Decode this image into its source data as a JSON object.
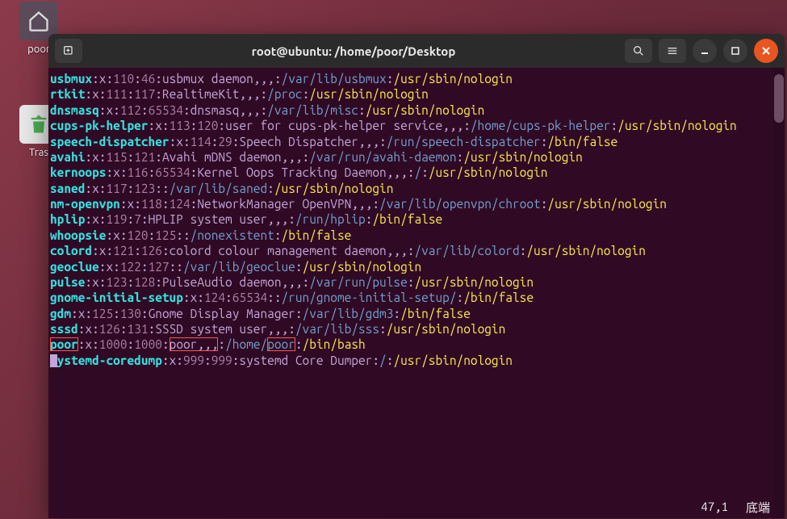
{
  "desktop": {
    "folder_label": "poor",
    "trash_label": "Tras"
  },
  "window": {
    "title": "root@ubuntu: /home/poor/Desktop"
  },
  "status": {
    "pos": "47,1",
    "cn": "底端"
  },
  "lines": [
    [
      {
        "c": "u",
        "t": "usbmux"
      },
      {
        "c": "sep",
        "t": ":"
      },
      {
        "c": "p",
        "t": "x"
      },
      {
        "c": "sep",
        "t": ":"
      },
      {
        "c": "n",
        "t": "110"
      },
      {
        "c": "sep",
        "t": ":"
      },
      {
        "c": "n",
        "t": "46"
      },
      {
        "c": "sep",
        "t": ":"
      },
      {
        "c": "p",
        "t": "usbmux daemon,,,"
      },
      {
        "c": "sep",
        "t": ":"
      },
      {
        "c": "path",
        "t": "/var/lib/usbmux"
      },
      {
        "c": "sep",
        "t": ":"
      },
      {
        "c": "shell",
        "t": "/usr/sbin/nologin"
      }
    ],
    [
      {
        "c": "u",
        "t": "rtkit"
      },
      {
        "c": "sep",
        "t": ":"
      },
      {
        "c": "p",
        "t": "x"
      },
      {
        "c": "sep",
        "t": ":"
      },
      {
        "c": "n",
        "t": "111"
      },
      {
        "c": "sep",
        "t": ":"
      },
      {
        "c": "n",
        "t": "117"
      },
      {
        "c": "sep",
        "t": ":"
      },
      {
        "c": "p",
        "t": "RealtimeKit,,,"
      },
      {
        "c": "sep",
        "t": ":"
      },
      {
        "c": "path",
        "t": "/proc"
      },
      {
        "c": "sep",
        "t": ":"
      },
      {
        "c": "shell",
        "t": "/usr/sbin/nologin"
      }
    ],
    [
      {
        "c": "u",
        "t": "dnsmasq"
      },
      {
        "c": "sep",
        "t": ":"
      },
      {
        "c": "p",
        "t": "x"
      },
      {
        "c": "sep",
        "t": ":"
      },
      {
        "c": "n",
        "t": "112"
      },
      {
        "c": "sep",
        "t": ":"
      },
      {
        "c": "n",
        "t": "65534"
      },
      {
        "c": "sep",
        "t": ":"
      },
      {
        "c": "p",
        "t": "dnsmasq,,,"
      },
      {
        "c": "sep",
        "t": ":"
      },
      {
        "c": "path",
        "t": "/var/lib/misc"
      },
      {
        "c": "sep",
        "t": ":"
      },
      {
        "c": "shell",
        "t": "/usr/sbin/nologin"
      }
    ],
    [
      {
        "c": "u",
        "t": "cups-pk-helper"
      },
      {
        "c": "sep",
        "t": ":"
      },
      {
        "c": "p",
        "t": "x"
      },
      {
        "c": "sep",
        "t": ":"
      },
      {
        "c": "n",
        "t": "113"
      },
      {
        "c": "sep",
        "t": ":"
      },
      {
        "c": "n",
        "t": "120"
      },
      {
        "c": "sep",
        "t": ":"
      },
      {
        "c": "p",
        "t": "user for cups-pk-helper service,,,"
      },
      {
        "c": "sep",
        "t": ":"
      },
      {
        "c": "path",
        "t": "/home/cups-pk-helper"
      },
      {
        "c": "sep",
        "t": ":"
      },
      {
        "c": "shell",
        "t": "/usr/sbin/nologin"
      }
    ],
    [
      {
        "c": "u",
        "t": "speech-dispatcher"
      },
      {
        "c": "sep",
        "t": ":"
      },
      {
        "c": "p",
        "t": "x"
      },
      {
        "c": "sep",
        "t": ":"
      },
      {
        "c": "n",
        "t": "114"
      },
      {
        "c": "sep",
        "t": ":"
      },
      {
        "c": "n",
        "t": "29"
      },
      {
        "c": "sep",
        "t": ":"
      },
      {
        "c": "p",
        "t": "Speech Dispatcher,,,"
      },
      {
        "c": "sep",
        "t": ":"
      },
      {
        "c": "path",
        "t": "/run/speech-dispatcher"
      },
      {
        "c": "sep",
        "t": ":"
      },
      {
        "c": "shell",
        "t": "/bin/false"
      }
    ],
    [
      {
        "c": "u",
        "t": "avahi"
      },
      {
        "c": "sep",
        "t": ":"
      },
      {
        "c": "p",
        "t": "x"
      },
      {
        "c": "sep",
        "t": ":"
      },
      {
        "c": "n",
        "t": "115"
      },
      {
        "c": "sep",
        "t": ":"
      },
      {
        "c": "n",
        "t": "121"
      },
      {
        "c": "sep",
        "t": ":"
      },
      {
        "c": "p",
        "t": "Avahi mDNS daemon,,,"
      },
      {
        "c": "sep",
        "t": ":"
      },
      {
        "c": "path",
        "t": "/var/run/avahi-daemon"
      },
      {
        "c": "sep",
        "t": ":"
      },
      {
        "c": "shell",
        "t": "/usr/sbin/nologin"
      }
    ],
    [
      {
        "c": "u",
        "t": "kernoops"
      },
      {
        "c": "sep",
        "t": ":"
      },
      {
        "c": "p",
        "t": "x"
      },
      {
        "c": "sep",
        "t": ":"
      },
      {
        "c": "n",
        "t": "116"
      },
      {
        "c": "sep",
        "t": ":"
      },
      {
        "c": "n",
        "t": "65534"
      },
      {
        "c": "sep",
        "t": ":"
      },
      {
        "c": "p",
        "t": "Kernel Oops Tracking Daemon,,,"
      },
      {
        "c": "sep",
        "t": ":"
      },
      {
        "c": "path",
        "t": "/"
      },
      {
        "c": "sep",
        "t": ":"
      },
      {
        "c": "shell",
        "t": "/usr/sbin/nologin"
      }
    ],
    [
      {
        "c": "u",
        "t": "saned"
      },
      {
        "c": "sep",
        "t": ":"
      },
      {
        "c": "p",
        "t": "x"
      },
      {
        "c": "sep",
        "t": ":"
      },
      {
        "c": "n",
        "t": "117"
      },
      {
        "c": "sep",
        "t": ":"
      },
      {
        "c": "n",
        "t": "123"
      },
      {
        "c": "sep",
        "t": ":"
      },
      {
        "c": "p",
        "t": ""
      },
      {
        "c": "sep",
        "t": ":"
      },
      {
        "c": "path",
        "t": "/var/lib/saned"
      },
      {
        "c": "sep",
        "t": ":"
      },
      {
        "c": "shell",
        "t": "/usr/sbin/nologin"
      }
    ],
    [
      {
        "c": "u",
        "t": "nm-openvpn"
      },
      {
        "c": "sep",
        "t": ":"
      },
      {
        "c": "p",
        "t": "x"
      },
      {
        "c": "sep",
        "t": ":"
      },
      {
        "c": "n",
        "t": "118"
      },
      {
        "c": "sep",
        "t": ":"
      },
      {
        "c": "n",
        "t": "124"
      },
      {
        "c": "sep",
        "t": ":"
      },
      {
        "c": "p",
        "t": "NetworkManager OpenVPN,,,"
      },
      {
        "c": "sep",
        "t": ":"
      },
      {
        "c": "path",
        "t": "/var/lib/openvpn/chroot"
      },
      {
        "c": "sep",
        "t": ":"
      },
      {
        "c": "shell",
        "t": "/usr/sbin/nologin"
      }
    ],
    [
      {
        "c": "u",
        "t": "hplip"
      },
      {
        "c": "sep",
        "t": ":"
      },
      {
        "c": "p",
        "t": "x"
      },
      {
        "c": "sep",
        "t": ":"
      },
      {
        "c": "n",
        "t": "119"
      },
      {
        "c": "sep",
        "t": ":"
      },
      {
        "c": "n",
        "t": "7"
      },
      {
        "c": "sep",
        "t": ":"
      },
      {
        "c": "p",
        "t": "HPLIP system user,,,"
      },
      {
        "c": "sep",
        "t": ":"
      },
      {
        "c": "path",
        "t": "/run/hplip"
      },
      {
        "c": "sep",
        "t": ":"
      },
      {
        "c": "shell",
        "t": "/bin/false"
      }
    ],
    [
      {
        "c": "u",
        "t": "whoopsie"
      },
      {
        "c": "sep",
        "t": ":"
      },
      {
        "c": "p",
        "t": "x"
      },
      {
        "c": "sep",
        "t": ":"
      },
      {
        "c": "n",
        "t": "120"
      },
      {
        "c": "sep",
        "t": ":"
      },
      {
        "c": "n",
        "t": "125"
      },
      {
        "c": "sep",
        "t": ":"
      },
      {
        "c": "p",
        "t": ""
      },
      {
        "c": "sep",
        "t": ":"
      },
      {
        "c": "path",
        "t": "/nonexistent"
      },
      {
        "c": "sep",
        "t": ":"
      },
      {
        "c": "shell",
        "t": "/bin/false"
      }
    ],
    [
      {
        "c": "u",
        "t": "colord"
      },
      {
        "c": "sep",
        "t": ":"
      },
      {
        "c": "p",
        "t": "x"
      },
      {
        "c": "sep",
        "t": ":"
      },
      {
        "c": "n",
        "t": "121"
      },
      {
        "c": "sep",
        "t": ":"
      },
      {
        "c": "n",
        "t": "126"
      },
      {
        "c": "sep",
        "t": ":"
      },
      {
        "c": "p",
        "t": "colord colour management daemon,,,"
      },
      {
        "c": "sep",
        "t": ":"
      },
      {
        "c": "path",
        "t": "/var/lib/colord"
      },
      {
        "c": "sep",
        "t": ":"
      },
      {
        "c": "shell",
        "t": "/usr/sbin/nologin"
      }
    ],
    [
      {
        "c": "u",
        "t": "geoclue"
      },
      {
        "c": "sep",
        "t": ":"
      },
      {
        "c": "p",
        "t": "x"
      },
      {
        "c": "sep",
        "t": ":"
      },
      {
        "c": "n",
        "t": "122"
      },
      {
        "c": "sep",
        "t": ":"
      },
      {
        "c": "n",
        "t": "127"
      },
      {
        "c": "sep",
        "t": ":"
      },
      {
        "c": "p",
        "t": ""
      },
      {
        "c": "sep",
        "t": ":"
      },
      {
        "c": "path",
        "t": "/var/lib/geoclue"
      },
      {
        "c": "sep",
        "t": ":"
      },
      {
        "c": "shell",
        "t": "/usr/sbin/nologin"
      }
    ],
    [
      {
        "c": "u",
        "t": "pulse"
      },
      {
        "c": "sep",
        "t": ":"
      },
      {
        "c": "p",
        "t": "x"
      },
      {
        "c": "sep",
        "t": ":"
      },
      {
        "c": "n",
        "t": "123"
      },
      {
        "c": "sep",
        "t": ":"
      },
      {
        "c": "n",
        "t": "128"
      },
      {
        "c": "sep",
        "t": ":"
      },
      {
        "c": "p",
        "t": "PulseAudio daemon,,,"
      },
      {
        "c": "sep",
        "t": ":"
      },
      {
        "c": "path",
        "t": "/var/run/pulse"
      },
      {
        "c": "sep",
        "t": ":"
      },
      {
        "c": "shell",
        "t": "/usr/sbin/nologin"
      }
    ],
    [
      {
        "c": "u",
        "t": "gnome-initial-setup"
      },
      {
        "c": "sep",
        "t": ":"
      },
      {
        "c": "p",
        "t": "x"
      },
      {
        "c": "sep",
        "t": ":"
      },
      {
        "c": "n",
        "t": "124"
      },
      {
        "c": "sep",
        "t": ":"
      },
      {
        "c": "n",
        "t": "65534"
      },
      {
        "c": "sep",
        "t": ":"
      },
      {
        "c": "p",
        "t": ""
      },
      {
        "c": "sep",
        "t": ":"
      },
      {
        "c": "path",
        "t": "/run/gnome-initial-setup/"
      },
      {
        "c": "sep",
        "t": ":"
      },
      {
        "c": "shell",
        "t": "/bin/false"
      }
    ],
    [
      {
        "c": "u",
        "t": "gdm"
      },
      {
        "c": "sep",
        "t": ":"
      },
      {
        "c": "p",
        "t": "x"
      },
      {
        "c": "sep",
        "t": ":"
      },
      {
        "c": "n",
        "t": "125"
      },
      {
        "c": "sep",
        "t": ":"
      },
      {
        "c": "n",
        "t": "130"
      },
      {
        "c": "sep",
        "t": ":"
      },
      {
        "c": "p",
        "t": "Gnome Display Manager"
      },
      {
        "c": "sep",
        "t": ":"
      },
      {
        "c": "path",
        "t": "/var/lib/gdm3"
      },
      {
        "c": "sep",
        "t": ":"
      },
      {
        "c": "shell",
        "t": "/bin/false"
      }
    ],
    [
      {
        "c": "u",
        "t": "sssd"
      },
      {
        "c": "sep",
        "t": ":"
      },
      {
        "c": "p",
        "t": "x"
      },
      {
        "c": "sep",
        "t": ":"
      },
      {
        "c": "n",
        "t": "126"
      },
      {
        "c": "sep",
        "t": ":"
      },
      {
        "c": "n",
        "t": "131"
      },
      {
        "c": "sep",
        "t": ":"
      },
      {
        "c": "p",
        "t": "SSSD system user,,,"
      },
      {
        "c": "sep",
        "t": ":"
      },
      {
        "c": "path",
        "t": "/var/lib/sss"
      },
      {
        "c": "sep",
        "t": ":"
      },
      {
        "c": "shell",
        "t": "/usr/sbin/nologin"
      }
    ],
    [
      {
        "c": "u",
        "t": "poor",
        "hl": true
      },
      {
        "c": "sep",
        "t": ":"
      },
      {
        "c": "p",
        "t": "x"
      },
      {
        "c": "sep",
        "t": ":"
      },
      {
        "c": "n",
        "t": "1000"
      },
      {
        "c": "sep",
        "t": ":"
      },
      {
        "c": "n",
        "t": "1000"
      },
      {
        "c": "sep",
        "t": ":"
      },
      {
        "c": "p",
        "t": "poor,,,",
        "hl": true
      },
      {
        "c": "sep",
        "t": ":"
      },
      {
        "c": "path",
        "t": "/home/"
      },
      {
        "c": "path",
        "t": "poor",
        "hl": true
      },
      {
        "c": "sep",
        "t": ":"
      },
      {
        "c": "shell",
        "t": "/bin/bash"
      }
    ],
    [
      {
        "c": "u",
        "t": "systemd-coredump",
        "cursor": true
      },
      {
        "c": "sep",
        "t": ":"
      },
      {
        "c": "p",
        "t": "x"
      },
      {
        "c": "sep",
        "t": ":"
      },
      {
        "c": "n",
        "t": "999"
      },
      {
        "c": "sep",
        "t": ":"
      },
      {
        "c": "n",
        "t": "999"
      },
      {
        "c": "sep",
        "t": ":"
      },
      {
        "c": "p",
        "t": "systemd Core Dumper"
      },
      {
        "c": "sep",
        "t": ":"
      },
      {
        "c": "path",
        "t": "/"
      },
      {
        "c": "sep",
        "t": ":"
      },
      {
        "c": "shell",
        "t": "/usr/sbin/nologin"
      }
    ]
  ]
}
